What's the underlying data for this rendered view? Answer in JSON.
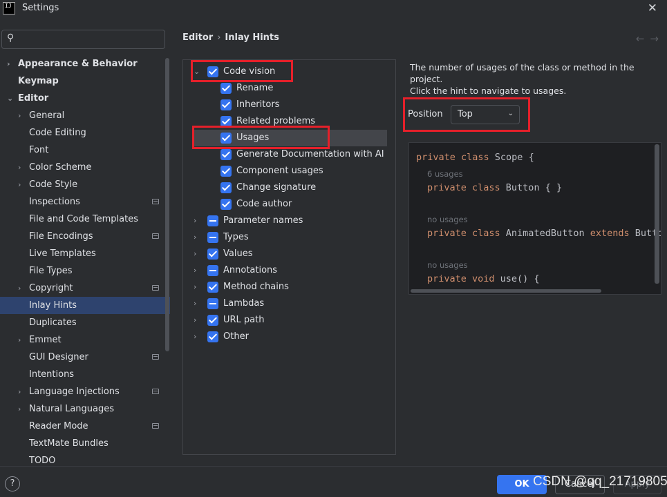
{
  "window": {
    "title": "Settings"
  },
  "search": {
    "placeholder": ""
  },
  "sidebar": {
    "items": [
      {
        "label": "Appearance & Behavior",
        "bold": true,
        "chevron": true,
        "indent": 0,
        "project": false
      },
      {
        "label": "Keymap",
        "bold": true,
        "chevron": false,
        "indent": 0,
        "project": false
      },
      {
        "label": "Editor",
        "bold": true,
        "chevron": "open",
        "indent": 0,
        "project": false
      },
      {
        "label": "General",
        "bold": false,
        "chevron": true,
        "indent": 1,
        "project": false
      },
      {
        "label": "Code Editing",
        "bold": false,
        "chevron": false,
        "indent": 1,
        "project": false
      },
      {
        "label": "Font",
        "bold": false,
        "chevron": false,
        "indent": 1,
        "project": false
      },
      {
        "label": "Color Scheme",
        "bold": false,
        "chevron": true,
        "indent": 1,
        "project": false
      },
      {
        "label": "Code Style",
        "bold": false,
        "chevron": true,
        "indent": 1,
        "project": false
      },
      {
        "label": "Inspections",
        "bold": false,
        "chevron": false,
        "indent": 1,
        "project": true
      },
      {
        "label": "File and Code Templates",
        "bold": false,
        "chevron": false,
        "indent": 1,
        "project": false
      },
      {
        "label": "File Encodings",
        "bold": false,
        "chevron": false,
        "indent": 1,
        "project": true
      },
      {
        "label": "Live Templates",
        "bold": false,
        "chevron": false,
        "indent": 1,
        "project": false
      },
      {
        "label": "File Types",
        "bold": false,
        "chevron": false,
        "indent": 1,
        "project": false
      },
      {
        "label": "Copyright",
        "bold": false,
        "chevron": true,
        "indent": 1,
        "project": true
      },
      {
        "label": "Inlay Hints",
        "bold": false,
        "chevron": false,
        "indent": 1,
        "project": false,
        "selected": true
      },
      {
        "label": "Duplicates",
        "bold": false,
        "chevron": false,
        "indent": 1,
        "project": false
      },
      {
        "label": "Emmet",
        "bold": false,
        "chevron": true,
        "indent": 1,
        "project": false
      },
      {
        "label": "GUI Designer",
        "bold": false,
        "chevron": false,
        "indent": 1,
        "project": true
      },
      {
        "label": "Intentions",
        "bold": false,
        "chevron": false,
        "indent": 1,
        "project": false
      },
      {
        "label": "Language Injections",
        "bold": false,
        "chevron": true,
        "indent": 1,
        "project": true
      },
      {
        "label": "Natural Languages",
        "bold": false,
        "chevron": true,
        "indent": 1,
        "project": false
      },
      {
        "label": "Reader Mode",
        "bold": false,
        "chevron": false,
        "indent": 1,
        "project": true
      },
      {
        "label": "TextMate Bundles",
        "bold": false,
        "chevron": false,
        "indent": 1,
        "project": false
      },
      {
        "label": "TODO",
        "bold": false,
        "chevron": false,
        "indent": 1,
        "project": false
      }
    ]
  },
  "breadcrumb": {
    "parent": "Editor",
    "separator": "›",
    "current": "Inlay Hints"
  },
  "tree": {
    "items": [
      {
        "label": "Code vision",
        "level": 0,
        "chevron": "open",
        "state": "checked"
      },
      {
        "label": "Rename",
        "level": 1,
        "state": "checked"
      },
      {
        "label": "Inheritors",
        "level": 1,
        "state": "checked"
      },
      {
        "label": "Related problems",
        "level": 1,
        "state": "checked"
      },
      {
        "label": "Usages",
        "level": 1,
        "state": "checked",
        "highlighted": true
      },
      {
        "label": "Generate Documentation with AI",
        "level": 1,
        "state": "checked"
      },
      {
        "label": "Component usages",
        "level": 1,
        "state": "checked"
      },
      {
        "label": "Change signature",
        "level": 1,
        "state": "checked"
      },
      {
        "label": "Code author",
        "level": 1,
        "state": "checked"
      },
      {
        "label": "Parameter names",
        "level": 0,
        "chevron": "closed",
        "state": "partial"
      },
      {
        "label": "Types",
        "level": 0,
        "chevron": "closed",
        "state": "partial"
      },
      {
        "label": "Values",
        "level": 0,
        "chevron": "closed",
        "state": "checked"
      },
      {
        "label": "Annotations",
        "level": 0,
        "chevron": "closed",
        "state": "partial"
      },
      {
        "label": "Method chains",
        "level": 0,
        "chevron": "closed",
        "state": "checked"
      },
      {
        "label": "Lambdas",
        "level": 0,
        "chevron": "closed",
        "state": "partial"
      },
      {
        "label": "URL path",
        "level": 0,
        "chevron": "closed",
        "state": "checked"
      },
      {
        "label": "Other",
        "level": 0,
        "chevron": "closed",
        "state": "checked"
      }
    ]
  },
  "details": {
    "description_line1": "The number of usages of the class or method in the project.",
    "description_line2": "Click the hint to navigate to usages.",
    "position_label": "Position",
    "position_value": "Top"
  },
  "preview": {
    "lines": {
      "l1_kw": "private class",
      "l1_rest": " Scope {",
      "h1": "6 usages",
      "l2_kw": "private class",
      "l2_rest": " Button { }",
      "h2": "no usages",
      "l3_kw": "private class",
      "l3_mid": " AnimatedButton ",
      "l3_kw2": "extends",
      "l3_rest": " Button",
      "h3": "no usages",
      "l4_kw": "private void",
      "l4_rest": " use() {"
    }
  },
  "footer": {
    "help": "?",
    "ok": "OK",
    "cancel": "Cancel",
    "apply": "Apply",
    "watermark": "CSDN @qq_21719805"
  },
  "colors": {
    "accent": "#3574f0",
    "selection": "#2e436e",
    "highlight_box": "#e5202a",
    "keyword": "#cf8e6d"
  },
  "icons": {
    "search": "search-icon",
    "close": "close-icon",
    "back": "arrow-left-icon",
    "forward": "arrow-right-icon",
    "help": "help-icon"
  }
}
